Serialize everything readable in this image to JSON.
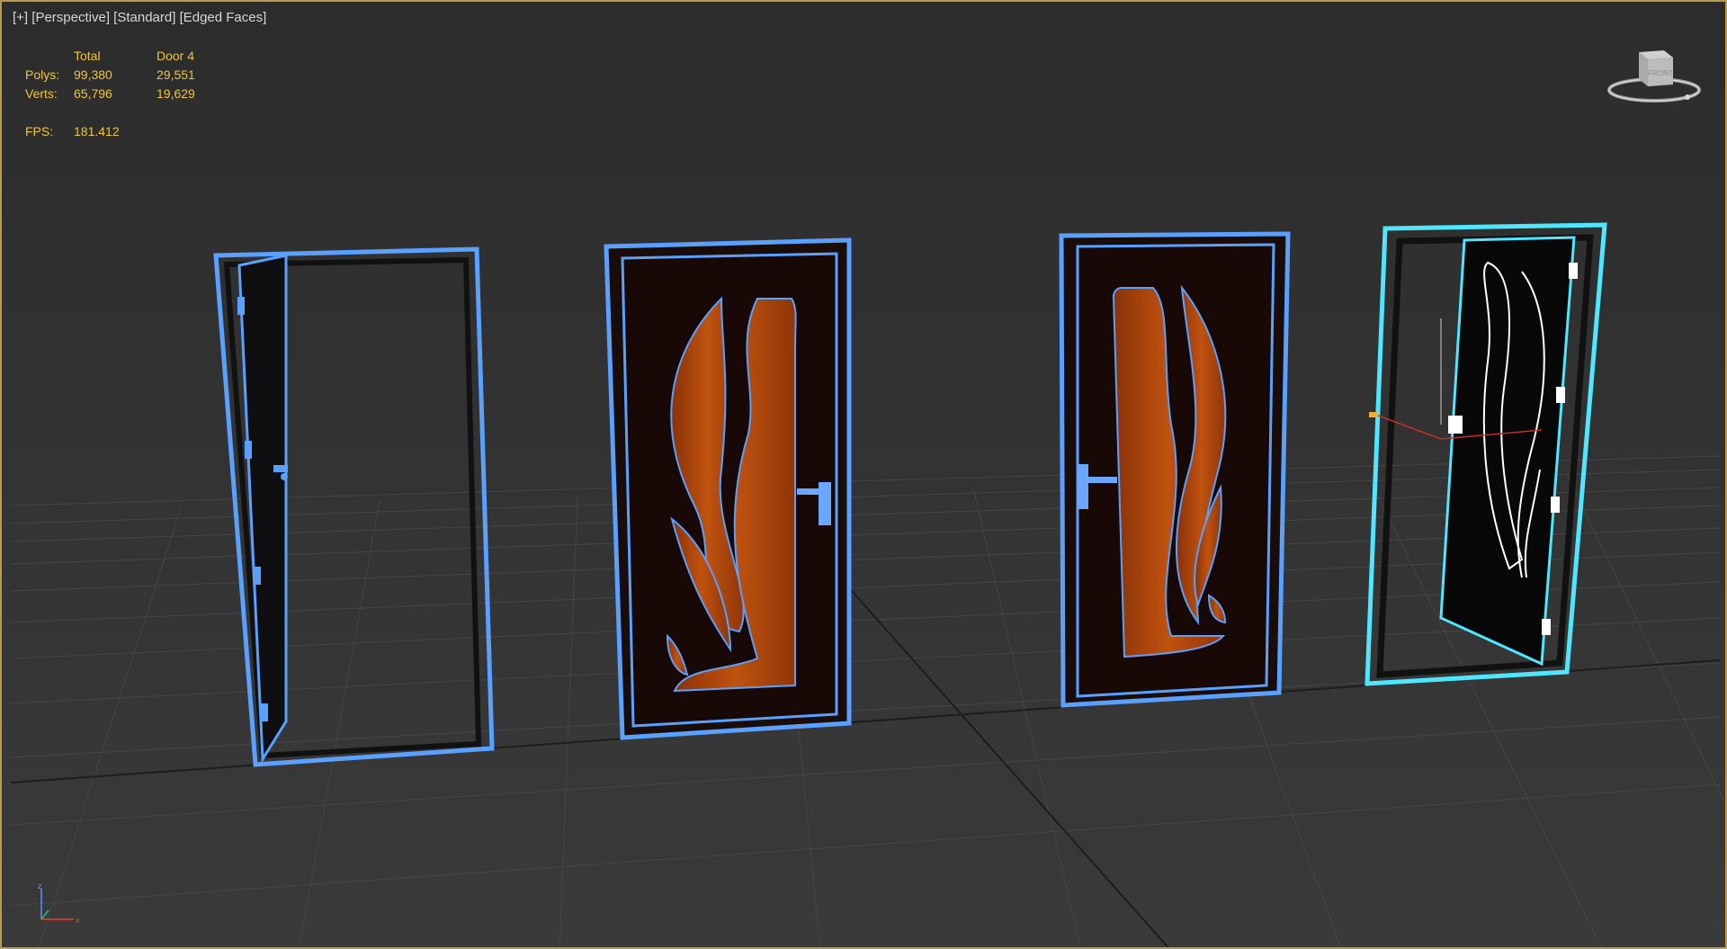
{
  "viewport": {
    "menu": [
      "[+]",
      "[Perspective]",
      "[Standard]",
      "[Edged Faces]"
    ],
    "stats": {
      "header": [
        "",
        "Total",
        "Door 4"
      ],
      "rows": [
        {
          "label": "Polys:",
          "total": "99,380",
          "selected": "29,551"
        },
        {
          "label": "Verts:",
          "total": "65,796",
          "selected": "19,629"
        }
      ],
      "fps_label": "FPS:",
      "fps_value": "181.412"
    },
    "viewcube_label": "FRONT",
    "axis_labels": {
      "z": "z",
      "x": "x"
    }
  },
  "colors": {
    "background": "#2f2f2f",
    "grid": "#474747",
    "selection_blue": "#5aa0ff",
    "selection_cyan": "#4ee7ff",
    "wood": "#b5480e",
    "door_panel": "#1a0c08",
    "stats_text": "#f0c63a"
  },
  "icons": [
    "viewcube-icon",
    "axis-tripod-icon",
    "door-handle-icon",
    "hinge-icon"
  ]
}
